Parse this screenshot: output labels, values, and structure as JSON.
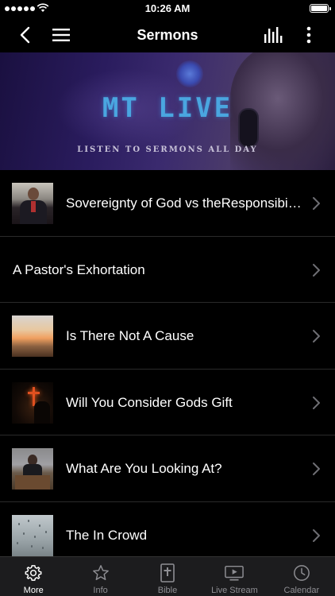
{
  "status_bar": {
    "time": "10:26 AM"
  },
  "nav": {
    "title": "Sermons"
  },
  "banner": {
    "title": "MT LIVE",
    "subtitle": "LISTEN TO SERMONS ALL DAY"
  },
  "sermons": [
    {
      "title": "Sovereignty of God vs theResponsibili...",
      "thumbnail": "pastor-photo"
    },
    {
      "title": "A Pastor's Exhortation",
      "thumbnail": ""
    },
    {
      "title": "Is There Not A Cause",
      "thumbnail": "sunset-photo"
    },
    {
      "title": "Will You Consider Gods Gift",
      "thumbnail": "cross-photo"
    },
    {
      "title": "What Are You Looking At?",
      "thumbnail": "pulpit-photo"
    },
    {
      "title": "The In Crowd",
      "thumbnail": "rain-photo"
    }
  ],
  "tabs": [
    {
      "label": "More",
      "icon": "gear-icon",
      "active": true
    },
    {
      "label": "Info",
      "icon": "star-icon",
      "active": false
    },
    {
      "label": "Bible",
      "icon": "bible-icon",
      "active": false
    },
    {
      "label": "Live Stream",
      "icon": "play-screen-icon",
      "active": false
    },
    {
      "label": "Calendar",
      "icon": "clock-icon",
      "active": false
    }
  ],
  "colors": {
    "background": "#000000",
    "tab_bar": "#1c1c1e",
    "banner_title": "#4aa6e0",
    "inactive_tab": "#8e8e93"
  }
}
